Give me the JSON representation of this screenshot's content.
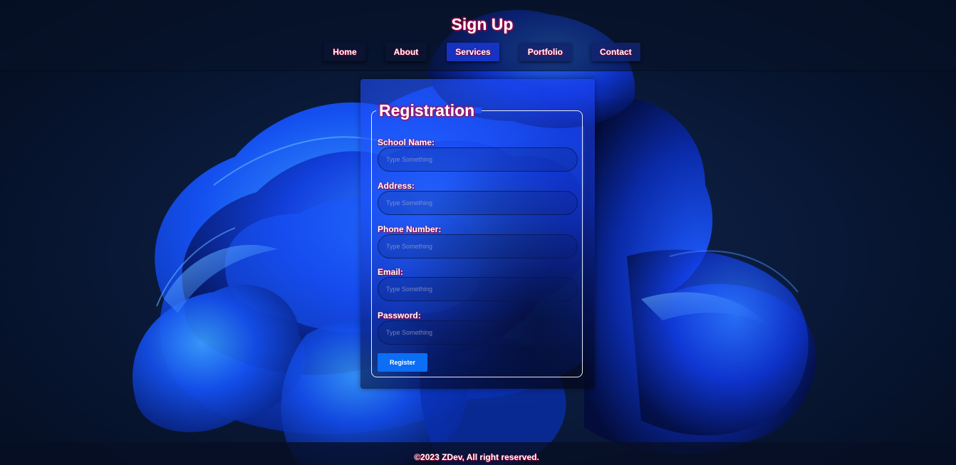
{
  "header": {
    "title": "Sign Up",
    "nav": [
      {
        "label": "Home"
      },
      {
        "label": "About"
      },
      {
        "label": "Services"
      },
      {
        "label": "Portfolio"
      },
      {
        "label": "Contact"
      }
    ]
  },
  "form": {
    "legend": "Registration",
    "fields": [
      {
        "label": "School Name:",
        "placeholder": "Type Something",
        "value": ""
      },
      {
        "label": "Address:",
        "placeholder": "Type Something",
        "value": ""
      },
      {
        "label": "Phone Number:",
        "placeholder": "Type Something",
        "value": ""
      },
      {
        "label": "Email:",
        "placeholder": "Type Something",
        "value": ""
      },
      {
        "label": "Password:",
        "placeholder": "Type Something",
        "value": ""
      }
    ],
    "submit_label": "Register"
  },
  "footer": {
    "copyright": "©2023 ZDev, All right reserved."
  },
  "colors": {
    "accent_blue": "#0b6ef5",
    "text_glow": "#b0003a",
    "background_dark": "#06122a"
  }
}
